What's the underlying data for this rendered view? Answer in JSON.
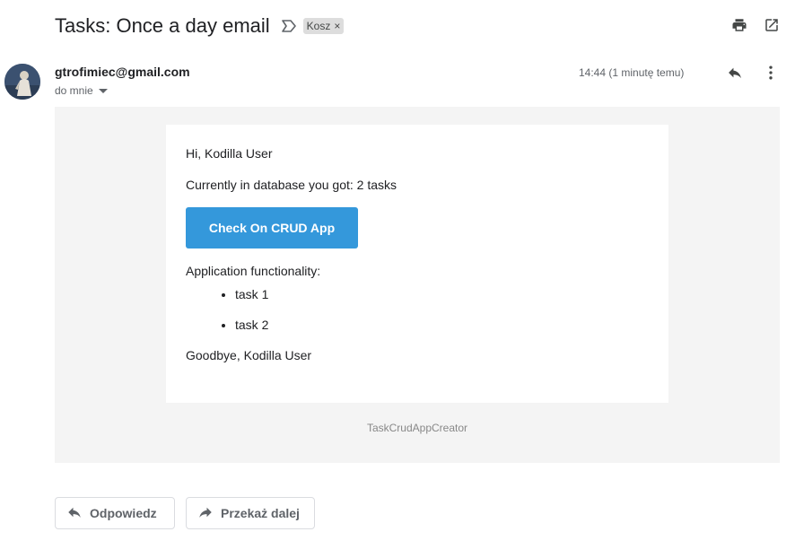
{
  "subject": "Tasks: Once a day email",
  "label": {
    "text": "Kosz",
    "remove": "×"
  },
  "icons": {
    "importance": "importance-marker-icon",
    "print": "print-icon",
    "open_new_window": "open-in-new-window-icon",
    "reply": "reply-icon",
    "more": "more-vert-icon",
    "dropdown": "caret-down-icon",
    "forward": "forward-icon"
  },
  "message": {
    "sender": "gtrofimiec@gmail.com",
    "recipient": "do mnie",
    "timestamp": "14:44 (1 minutę temu)"
  },
  "body": {
    "greeting": "Hi, Kodilla User",
    "count_text": "Currently in database you got: 2 tasks",
    "button_label": "Check On CRUD App",
    "functionality_heading": "Application functionality:",
    "tasks": [
      "task 1",
      "task 2"
    ],
    "goodbye": "Goodbye, Kodilla User",
    "footer": "TaskCrudAppCreator"
  },
  "actions": {
    "reply_label": "Odpowiedz",
    "forward_label": "Przekaż dalej"
  },
  "colors": {
    "cta_background": "#3498db",
    "body_background": "#f4f4f4",
    "label_chip": "#dddddd"
  }
}
